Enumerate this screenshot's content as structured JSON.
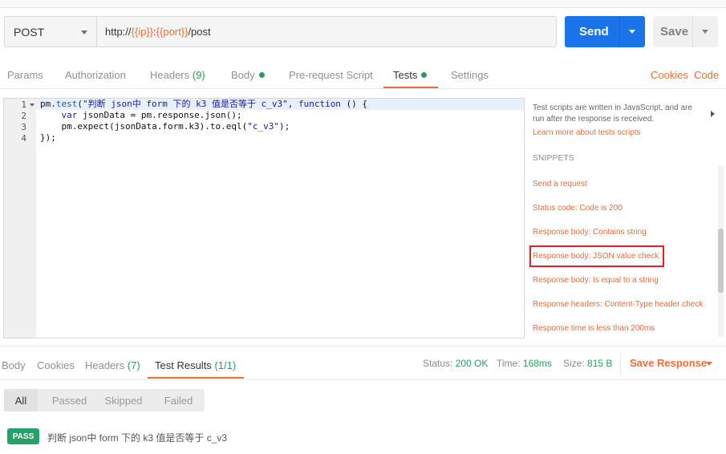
{
  "request": {
    "method": "POST",
    "url_prefix": "http://",
    "url_var_ip": "{{ip}}",
    "url_colon": ":",
    "url_var_port": "{{port}}",
    "url_suffix": "/post",
    "send_label": "Send",
    "save_label": "Save"
  },
  "req_tabs": {
    "params": "Params",
    "authorization": "Authorization",
    "headers": "Headers",
    "headers_count": "(9)",
    "body": "Body",
    "pre_request": "Pre-request Script",
    "tests": "Tests",
    "settings": "Settings",
    "cookies": "Cookies",
    "code": "Code"
  },
  "editor": {
    "line_numbers": [
      "1",
      "2",
      "3",
      "4"
    ],
    "line1_a": "pm.",
    "line1_fn": "test",
    "line1_b": "(",
    "line1_str": "\"判断 json中 form 下的 k3 值是否等于 c_v3\"",
    "line1_c": ", ",
    "line1_kw": "function",
    "line1_d": " () {",
    "line2_indent": "    ",
    "line2_kw": "var",
    "line2_rest": " jsonData = pm.response.json();",
    "line3_a": "    pm.expect(jsonData.form.k3).to.eql(",
    "line3_str": "\"c_v3\"",
    "line3_b": ");",
    "line4": "});"
  },
  "snippets_panel": {
    "description": "Test scripts are written in JavaScript, and are run after the response is received.",
    "learn_more": "Learn more about tests scripts",
    "heading": "SNIPPETS",
    "items": [
      "Send a request",
      "Status code: Code is 200",
      "Response body: Contains string",
      "Response body: JSON value check",
      "Response body: Is equal to a string",
      "Response headers: Content-Type header check",
      "Response time is less than 200ms"
    ]
  },
  "response": {
    "tabs": {
      "body": "Body",
      "cookies": "Cookies",
      "headers": "Headers",
      "headers_count": "(7)",
      "test_results": "Test Results",
      "test_results_count": "(1/1)"
    },
    "status_label": "Status:",
    "status_value": "200 OK",
    "time_label": "Time:",
    "time_value": "168ms",
    "size_label": "Size:",
    "size_value": "815 B",
    "save_response": "Save Response",
    "filters": [
      "All",
      "Passed",
      "Skipped",
      "Failed"
    ],
    "result_badge": "PASS",
    "result_name": "判断 json中 form 下的 k3 值是否等于 c_v3"
  },
  "colors": {
    "accent": "#f26b3a",
    "send_blue": "#1a73e8",
    "success_green": "#26a269",
    "highlight_red": "#e0202a"
  }
}
